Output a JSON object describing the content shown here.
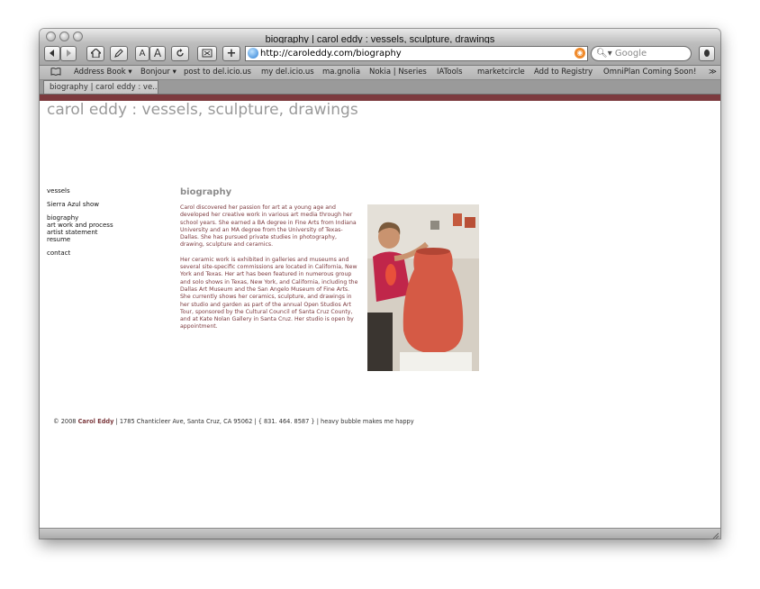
{
  "window": {
    "title": "biography | carol eddy : vessels, sculpture, drawings"
  },
  "toolbar": {
    "back_icon": "back-arrow-icon",
    "forward_icon": "forward-arrow-icon",
    "text_small": "A",
    "text_large": "A",
    "add_label": "+",
    "url": "http://caroleddy.com/biography",
    "search_placeholder": "Google"
  },
  "bookmarks": {
    "items": [
      "Address Book ▾",
      "Bonjour ▾",
      "post to del.icio.us",
      "my del.icio.us",
      "ma.gnolia",
      "Nokia | Nseries",
      "IATools",
      "marketcircle",
      "Add to Registry",
      "OmniPlan Coming Soon!"
    ],
    "overflow": "≫"
  },
  "tab": {
    "label": "biography | carol eddy : ve..."
  },
  "site": {
    "title": "carol eddy : vessels, sculpture, drawings",
    "nav": {
      "vessels": "vessels",
      "sierra": "Sierra Azul show",
      "biography": "biography",
      "process": "art work and process",
      "statement": "artist statement",
      "resume": "resume",
      "contact": "contact"
    },
    "heading": "biography",
    "bio": [
      "Carol discovered her passion for art at a young age and developed her creative work in various art media through her school years. She earned a BA degree in Fine Arts from Indiana University and an MA degree from the University of Texas-Dallas. She has pursued private studies in photography, drawing, sculpture and ceramics.",
      "Her ceramic work is exhibited in galleries and museums and several site-specific commissions are located in California, New York and Texas.  Her art has been featured in numerous group and solo shows in Texas, New York, and California, including the Dallas Art Museum and the San Angelo Museum of Fine Arts. She currently shows her ceramics, sculpture, and drawings in her studio and garden as part of the annual Open Studios Art Tour, sponsored by the Cultural Council of Santa Cruz County, and at Kate Nolan Gallery in Santa Cruz. Her studio is open by appointment."
    ],
    "footer": {
      "copyright": "© 2008 ",
      "name": "Carol Eddy",
      "rest": " | 1785 Chanticleer Ave, Santa Cruz, CA 95062 | { 831. 464. 8587 } | heavy bubble makes me happy"
    }
  },
  "colors": {
    "accent": "#7c3a3e",
    "title_gray": "#9a9a9a"
  }
}
